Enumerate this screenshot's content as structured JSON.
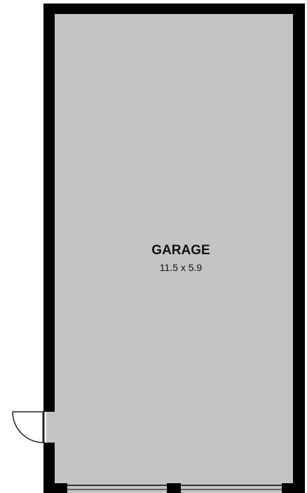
{
  "room": {
    "name": "GARAGE",
    "dimensions": "11.5 x 5.9"
  },
  "colors": {
    "floor": "#c4c4c4",
    "wall": "#000000",
    "background": "#ffffff",
    "door": "#222222"
  }
}
